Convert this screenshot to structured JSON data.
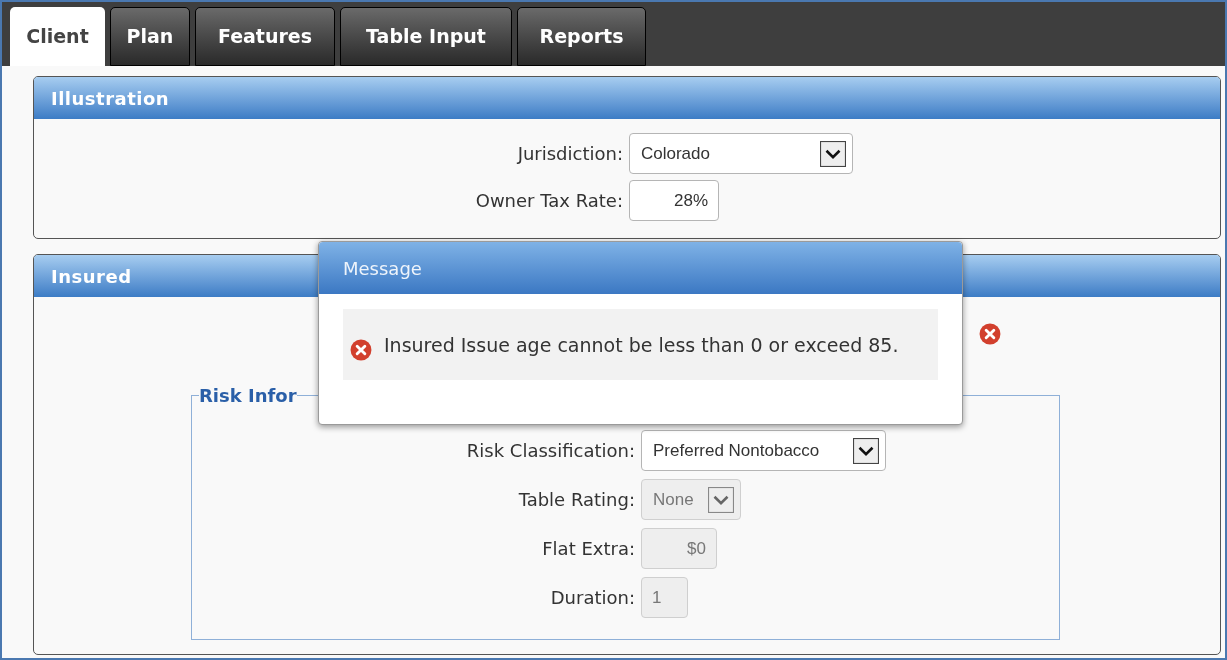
{
  "tabs": [
    {
      "label": "Client",
      "selected": true
    },
    {
      "label": "Plan",
      "selected": false
    },
    {
      "label": "Features",
      "selected": false
    },
    {
      "label": "Table Input",
      "selected": false
    },
    {
      "label": "Reports",
      "selected": false
    }
  ],
  "sections": [
    {
      "title": "Illustration",
      "error": false,
      "fields": [
        {
          "kind": "select",
          "label": "Jurisdiction:",
          "value": "Colorado",
          "disabled": false
        },
        {
          "kind": "amount",
          "label": "Owner Tax Rate:",
          "value": "28%",
          "disabled": false
        }
      ]
    },
    {
      "title": "Insured",
      "error": true,
      "group": {
        "legend": "Risk Infor",
        "fields": [
          {
            "kind": "select",
            "label": "Risk Classification:",
            "value": "Preferred Nontobacco",
            "disabled": false
          },
          {
            "kind": "select",
            "label": "Table Rating:",
            "value": "None",
            "disabled": true
          },
          {
            "kind": "amount",
            "label": "Flat Extra:",
            "value": "$0",
            "disabled": true
          },
          {
            "kind": "number",
            "label": "Duration:",
            "value": "1",
            "disabled": true
          }
        ]
      }
    }
  ],
  "dialog": {
    "title": "Message",
    "message": "Insured Issue age cannot be less than 0 or exceed 85."
  }
}
